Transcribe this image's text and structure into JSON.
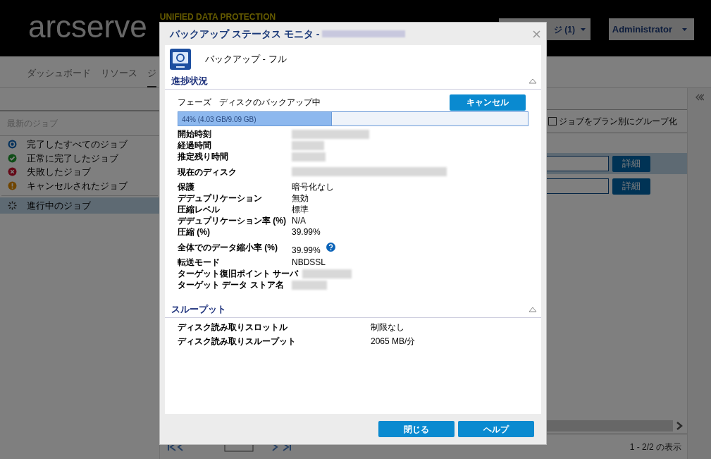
{
  "header": {
    "logo": "arcserve",
    "tagline": "UNIFIED DATA PROTECTION",
    "buttons": [
      {
        "label": "ジ (1)"
      },
      {
        "label": "Administrator"
      }
    ]
  },
  "nav_tabs": [
    {
      "label": "ダッシュボード",
      "selected": false
    },
    {
      "label": "リソース",
      "selected": false
    },
    {
      "label": "ジ",
      "selected": true
    }
  ],
  "sidebar": {
    "heading": "最新のジョブ",
    "items": [
      {
        "label": "完了したすべてのジョブ",
        "kind": "all",
        "selected": false
      },
      {
        "label": "正常に完了したジョブ",
        "kind": "success",
        "selected": false
      },
      {
        "label": "失敗したジョブ",
        "kind": "failed",
        "selected": false
      },
      {
        "label": "キャンセルされたジョブ",
        "kind": "cancelled",
        "selected": false
      },
      {
        "label": "進行中のジョブ",
        "kind": "running",
        "selected": true
      }
    ]
  },
  "job_list": {
    "group_by_plan": {
      "label": "ジョブをプラン別にグループ化",
      "checked": false
    },
    "rows": [
      {
        "button": "詳細",
        "selected": true
      },
      {
        "button": "詳細",
        "selected": false
      }
    ],
    "footer": "1 - 2/2 の表示"
  },
  "dialog": {
    "title": "バックアップ ステータス モニタ -",
    "job_type": "バックアップ - フル",
    "progress_section": {
      "title": "進捗状況",
      "expanded": true,
      "phase_label": "フェーズ",
      "phase": "ディスクのバックアップ中",
      "cancel_button": "キャンセル",
      "progress": {
        "level": 0.44,
        "label": "44% (4.03 GB/9.09 GB)"
      },
      "fields": [
        {
          "label": "開始時刻",
          "kind": "blurred"
        },
        {
          "label": "経過時間",
          "kind": "blurred"
        },
        {
          "label": "推定残り時間",
          "kind": "blurred"
        },
        {
          "label": "現在のディスク",
          "kind": "blurred"
        },
        {
          "label": "保護",
          "kind": "text",
          "value": "暗号化なし"
        },
        {
          "label": "デデュプリケーション",
          "kind": "text",
          "value": "無効"
        },
        {
          "label": "圧縮レベル",
          "kind": "text",
          "value": "標準"
        },
        {
          "label": "デデュプリケーション率 (%)",
          "kind": "text",
          "value": "N/A"
        },
        {
          "label": "圧縮 (%)",
          "kind": "text",
          "value": "39.99%"
        },
        {
          "label": "全体でのデータ縮小率 (%)",
          "kind": "text_help",
          "value": "39.99%"
        },
        {
          "label": "転送モード",
          "kind": "text",
          "value": "NBDSSL"
        },
        {
          "label": "ターゲット復旧ポイント サーバ",
          "kind": "blurred"
        },
        {
          "label": "ターゲット データ ストア名",
          "kind": "blurred"
        }
      ]
    },
    "throughput_section": {
      "title": "スループット",
      "expanded": true,
      "fields": [
        {
          "label": "ディスク読み取りスロットル",
          "value": "制限なし"
        },
        {
          "label": "ディスク読み取りスループット",
          "value": "2065 MB/分"
        }
      ]
    },
    "buttons": [
      "閉じる",
      "ヘルプ"
    ]
  }
}
